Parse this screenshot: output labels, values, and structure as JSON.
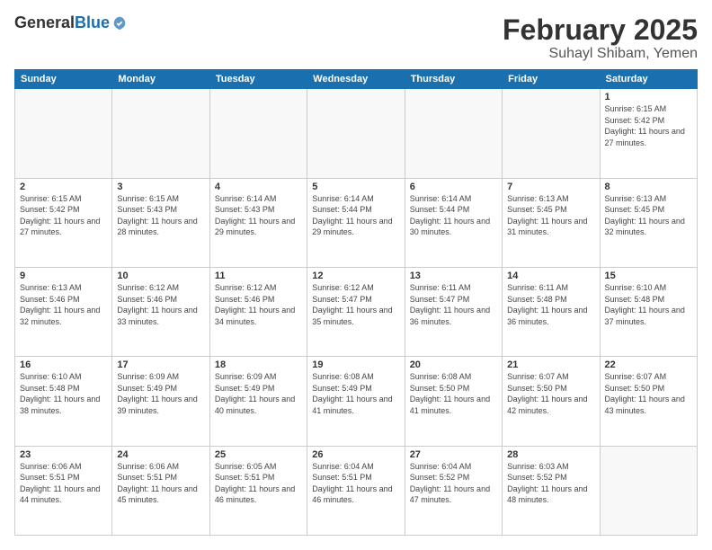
{
  "logo": {
    "general": "General",
    "blue": "Blue"
  },
  "header": {
    "title": "February 2025",
    "subtitle": "Suhayl Shibam, Yemen"
  },
  "days_of_week": [
    "Sunday",
    "Monday",
    "Tuesday",
    "Wednesday",
    "Thursday",
    "Friday",
    "Saturday"
  ],
  "weeks": [
    [
      {
        "day": "",
        "info": ""
      },
      {
        "day": "",
        "info": ""
      },
      {
        "day": "",
        "info": ""
      },
      {
        "day": "",
        "info": ""
      },
      {
        "day": "",
        "info": ""
      },
      {
        "day": "",
        "info": ""
      },
      {
        "day": "1",
        "info": "Sunrise: 6:15 AM\nSunset: 5:42 PM\nDaylight: 11 hours and 27 minutes."
      }
    ],
    [
      {
        "day": "2",
        "info": "Sunrise: 6:15 AM\nSunset: 5:42 PM\nDaylight: 11 hours and 27 minutes."
      },
      {
        "day": "3",
        "info": "Sunrise: 6:15 AM\nSunset: 5:43 PM\nDaylight: 11 hours and 28 minutes."
      },
      {
        "day": "4",
        "info": "Sunrise: 6:14 AM\nSunset: 5:43 PM\nDaylight: 11 hours and 29 minutes."
      },
      {
        "day": "5",
        "info": "Sunrise: 6:14 AM\nSunset: 5:44 PM\nDaylight: 11 hours and 29 minutes."
      },
      {
        "day": "6",
        "info": "Sunrise: 6:14 AM\nSunset: 5:44 PM\nDaylight: 11 hours and 30 minutes."
      },
      {
        "day": "7",
        "info": "Sunrise: 6:13 AM\nSunset: 5:45 PM\nDaylight: 11 hours and 31 minutes."
      },
      {
        "day": "8",
        "info": "Sunrise: 6:13 AM\nSunset: 5:45 PM\nDaylight: 11 hours and 32 minutes."
      }
    ],
    [
      {
        "day": "9",
        "info": "Sunrise: 6:13 AM\nSunset: 5:46 PM\nDaylight: 11 hours and 32 minutes."
      },
      {
        "day": "10",
        "info": "Sunrise: 6:12 AM\nSunset: 5:46 PM\nDaylight: 11 hours and 33 minutes."
      },
      {
        "day": "11",
        "info": "Sunrise: 6:12 AM\nSunset: 5:46 PM\nDaylight: 11 hours and 34 minutes."
      },
      {
        "day": "12",
        "info": "Sunrise: 6:12 AM\nSunset: 5:47 PM\nDaylight: 11 hours and 35 minutes."
      },
      {
        "day": "13",
        "info": "Sunrise: 6:11 AM\nSunset: 5:47 PM\nDaylight: 11 hours and 36 minutes."
      },
      {
        "day": "14",
        "info": "Sunrise: 6:11 AM\nSunset: 5:48 PM\nDaylight: 11 hours and 36 minutes."
      },
      {
        "day": "15",
        "info": "Sunrise: 6:10 AM\nSunset: 5:48 PM\nDaylight: 11 hours and 37 minutes."
      }
    ],
    [
      {
        "day": "16",
        "info": "Sunrise: 6:10 AM\nSunset: 5:48 PM\nDaylight: 11 hours and 38 minutes."
      },
      {
        "day": "17",
        "info": "Sunrise: 6:09 AM\nSunset: 5:49 PM\nDaylight: 11 hours and 39 minutes."
      },
      {
        "day": "18",
        "info": "Sunrise: 6:09 AM\nSunset: 5:49 PM\nDaylight: 11 hours and 40 minutes."
      },
      {
        "day": "19",
        "info": "Sunrise: 6:08 AM\nSunset: 5:49 PM\nDaylight: 11 hours and 41 minutes."
      },
      {
        "day": "20",
        "info": "Sunrise: 6:08 AM\nSunset: 5:50 PM\nDaylight: 11 hours and 41 minutes."
      },
      {
        "day": "21",
        "info": "Sunrise: 6:07 AM\nSunset: 5:50 PM\nDaylight: 11 hours and 42 minutes."
      },
      {
        "day": "22",
        "info": "Sunrise: 6:07 AM\nSunset: 5:50 PM\nDaylight: 11 hours and 43 minutes."
      }
    ],
    [
      {
        "day": "23",
        "info": "Sunrise: 6:06 AM\nSunset: 5:51 PM\nDaylight: 11 hours and 44 minutes."
      },
      {
        "day": "24",
        "info": "Sunrise: 6:06 AM\nSunset: 5:51 PM\nDaylight: 11 hours and 45 minutes."
      },
      {
        "day": "25",
        "info": "Sunrise: 6:05 AM\nSunset: 5:51 PM\nDaylight: 11 hours and 46 minutes."
      },
      {
        "day": "26",
        "info": "Sunrise: 6:04 AM\nSunset: 5:51 PM\nDaylight: 11 hours and 46 minutes."
      },
      {
        "day": "27",
        "info": "Sunrise: 6:04 AM\nSunset: 5:52 PM\nDaylight: 11 hours and 47 minutes."
      },
      {
        "day": "28",
        "info": "Sunrise: 6:03 AM\nSunset: 5:52 PM\nDaylight: 11 hours and 48 minutes."
      },
      {
        "day": "",
        "info": ""
      }
    ]
  ]
}
